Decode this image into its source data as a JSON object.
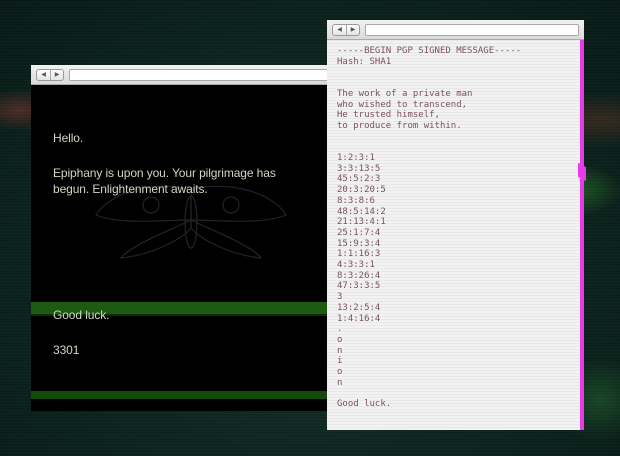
{
  "left_window": {
    "nav": {
      "back_icon": "back-arrow-icon",
      "forward_icon": "forward-arrow-icon"
    },
    "hello": "Hello.",
    "paragraph_line1": "Epiphany is upon you.  Your pilgrimage has",
    "paragraph_line2": "begun.  Enlightenment awaits.",
    "good_luck": "Good luck.",
    "number": "3301"
  },
  "right_window": {
    "nav": {
      "back_icon": "back-arrow-icon",
      "forward_icon": "forward-arrow-icon"
    },
    "pgp_lines": [
      "-----BEGIN PGP SIGNED MESSAGE-----",
      "Hash: SHA1",
      "",
      "",
      "The work of a private man",
      "who wished to transcend,",
      "He trusted himself,",
      "to produce from within.",
      "",
      "",
      "1:2:3:1",
      "3:3:13:5",
      "45:5:2:3",
      "20:3:20:5",
      "8:3:8:6",
      "48:5:14:2",
      "21:13:4:1",
      "25:1:7:4",
      "15:9:3:4",
      "1:1:16:3",
      "4:3:3:1",
      "8:3:26:4",
      "47:3:3:5",
      "3",
      "13:2:5:4",
      "1:4:16:4",
      ".",
      "o",
      "n",
      "i",
      "o",
      "n",
      "",
      "Good luck."
    ]
  },
  "colors": {
    "left_bg": "#000000",
    "left_text": "#cfd8c2",
    "band_green": "#1e5b12",
    "right_text": "#7a5064",
    "magenta_edge": "#e83ae8"
  }
}
